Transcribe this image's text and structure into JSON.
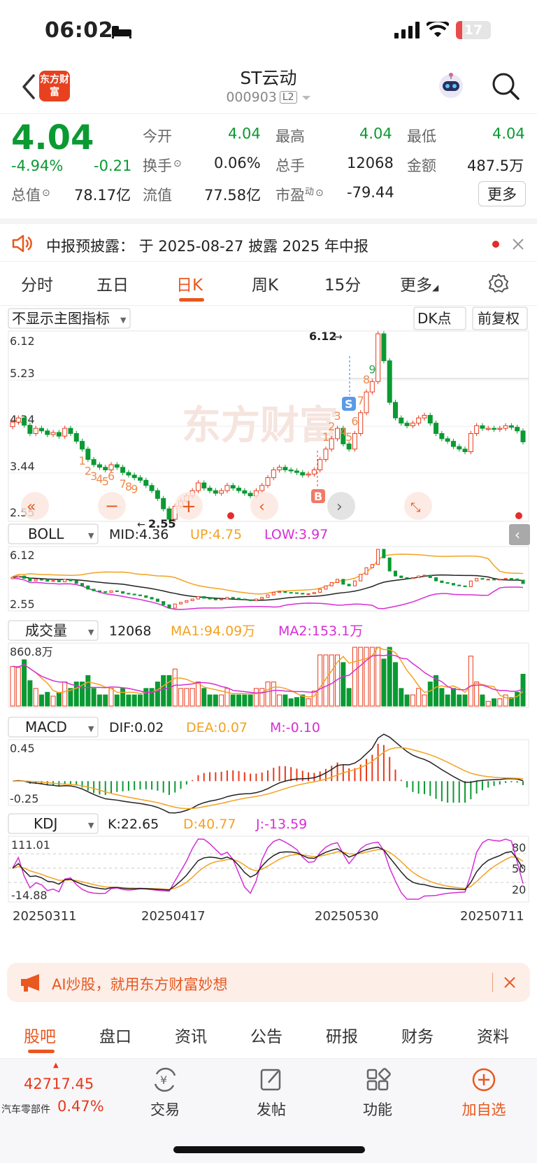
{
  "status_bar": {
    "time": "06:02",
    "battery": "17",
    "battery_level": 0.17
  },
  "header": {
    "title": "ST云动",
    "code": "000903",
    "level": "L2",
    "logo_text": "东方财富"
  },
  "quote": {
    "price": "4.04",
    "change_pct": "-4.94%",
    "change": "-0.21",
    "fields": [
      {
        "label": "今开",
        "value": "4.04"
      },
      {
        "label": "最高",
        "value": "4.04"
      },
      {
        "label": "最低",
        "value": "4.04"
      },
      {
        "label": "换手",
        "value": "0.06%"
      },
      {
        "label": "总手",
        "value": "12068"
      },
      {
        "label": "金额",
        "value": "487.5万"
      },
      {
        "label": "总值",
        "value": "78.17亿"
      },
      {
        "label": "流值",
        "value": "77.58亿"
      },
      {
        "label": "市盈",
        "sup": "动",
        "value": "-79.44"
      }
    ],
    "more_label": "更多"
  },
  "notice": {
    "text": "中报预披露：  于 2025-08-27 披露 2025 年中报"
  },
  "period_tabs": [
    "分时",
    "五日",
    "日K",
    "周K",
    "15分",
    "更多"
  ],
  "active_tab": "日K",
  "chart_toolbar": {
    "indicator_select": "不显示主图指标",
    "dk": "DK点",
    "adjust": "前复权"
  },
  "main_chart": {
    "ytick_labels": [
      "6.12",
      "5.23",
      "4.34",
      "3.44",
      "2.55"
    ],
    "high_marker": "6.12",
    "low_marker": "2.55",
    "watermark": "东方财富",
    "buy_label": "B",
    "sell_label": "S"
  },
  "boll": {
    "name": "BOLL",
    "mid": "MID:4.36",
    "up": "UP:4.75",
    "low": "LOW:3.97",
    "top": "6.12",
    "bottom": "2.55"
  },
  "volume": {
    "name": "成交量",
    "value": "12068",
    "ma1": "MA1:94.09万",
    "ma2": "MA2:153.1万",
    "top": "860.8万"
  },
  "macd": {
    "name": "MACD",
    "dif": "DIF:0.02",
    "dea": "DEA:0.07",
    "m": "M:-0.10",
    "top": "0.45",
    "bottom": "-0.25"
  },
  "kdj": {
    "name": "KDJ",
    "k": "K:22.65",
    "d": "D:40.77",
    "j": "J:-13.59",
    "top": "111.01",
    "bottom": "-14.88",
    "levels": [
      "80",
      "50",
      "20"
    ]
  },
  "dates": [
    "20250311",
    "20250417",
    "20250530",
    "20250711"
  ],
  "chart_data": {
    "type": "candlestick",
    "title": "",
    "dates_shown": [
      "20250311",
      "20250417",
      "20250530",
      "20250711"
    ],
    "ylim": [
      2.55,
      6.12
    ],
    "close": [
      4.42,
      4.5,
      4.36,
      4.2,
      4.3,
      4.25,
      4.18,
      4.22,
      4.15,
      4.3,
      4.2,
      4.05,
      3.9,
      3.7,
      3.6,
      3.55,
      3.5,
      3.6,
      3.55,
      3.45,
      3.4,
      3.35,
      3.3,
      3.2,
      3.1,
      2.95,
      2.75,
      2.55,
      2.8,
      2.9,
      3.0,
      3.1,
      3.25,
      3.15,
      3.1,
      3.05,
      3.1,
      3.2,
      3.15,
      3.1,
      3.05,
      3.0,
      3.1,
      3.2,
      3.35,
      3.5,
      3.55,
      3.5,
      3.48,
      3.45,
      3.4,
      3.42,
      3.5,
      3.7,
      3.9,
      4.1,
      4.3,
      4.0,
      3.9,
      4.2,
      4.6,
      5.0,
      5.2,
      6.12,
      5.6,
      4.8,
      4.5,
      4.4,
      4.35,
      4.4,
      4.5,
      4.55,
      4.4,
      4.2,
      4.1,
      4.05,
      3.95,
      3.9,
      3.85,
      4.2,
      4.35,
      4.3,
      4.3,
      4.28,
      4.3,
      4.35,
      4.32,
      4.25,
      4.04
    ],
    "volume_top": "860.8万",
    "boll": {
      "mid": 4.36,
      "up": 4.75,
      "low": 3.97
    },
    "macd": {
      "dif": 0.02,
      "dea": 0.07,
      "m": -0.1
    },
    "kdj": {
      "k": 22.65,
      "d": 40.77,
      "j": -13.59
    }
  },
  "ai_banner": {
    "text": "AI炒股，就用东方财富妙想"
  },
  "bottom_tabs": [
    "股吧",
    "盘口",
    "资讯",
    "公告",
    "研报",
    "财务",
    "资料"
  ],
  "dock": {
    "index_value": "42717.45",
    "index_name": "汽车零部件",
    "index_change": "0.47%",
    "items": [
      "交易",
      "发帖",
      "功能",
      "加自选"
    ]
  },
  "colors": {
    "up": "#e8391a",
    "down": "#0a9a32",
    "accent": "#e8581f",
    "boll_up": "#f3a221",
    "boll_low": "#d62ed6"
  }
}
